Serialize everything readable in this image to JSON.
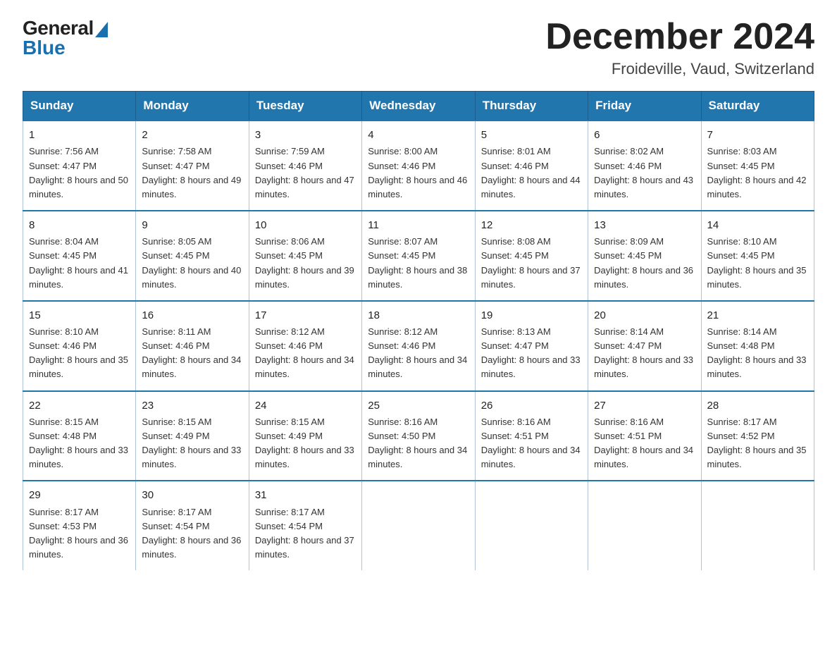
{
  "header": {
    "logo_general": "General",
    "logo_blue": "Blue",
    "month_title": "December 2024",
    "location": "Froideville, Vaud, Switzerland"
  },
  "days_of_week": [
    "Sunday",
    "Monday",
    "Tuesday",
    "Wednesday",
    "Thursday",
    "Friday",
    "Saturday"
  ],
  "weeks": [
    [
      {
        "day": "1",
        "sunrise": "7:56 AM",
        "sunset": "4:47 PM",
        "daylight": "8 hours and 50 minutes."
      },
      {
        "day": "2",
        "sunrise": "7:58 AM",
        "sunset": "4:47 PM",
        "daylight": "8 hours and 49 minutes."
      },
      {
        "day": "3",
        "sunrise": "7:59 AM",
        "sunset": "4:46 PM",
        "daylight": "8 hours and 47 minutes."
      },
      {
        "day": "4",
        "sunrise": "8:00 AM",
        "sunset": "4:46 PM",
        "daylight": "8 hours and 46 minutes."
      },
      {
        "day": "5",
        "sunrise": "8:01 AM",
        "sunset": "4:46 PM",
        "daylight": "8 hours and 44 minutes."
      },
      {
        "day": "6",
        "sunrise": "8:02 AM",
        "sunset": "4:46 PM",
        "daylight": "8 hours and 43 minutes."
      },
      {
        "day": "7",
        "sunrise": "8:03 AM",
        "sunset": "4:45 PM",
        "daylight": "8 hours and 42 minutes."
      }
    ],
    [
      {
        "day": "8",
        "sunrise": "8:04 AM",
        "sunset": "4:45 PM",
        "daylight": "8 hours and 41 minutes."
      },
      {
        "day": "9",
        "sunrise": "8:05 AM",
        "sunset": "4:45 PM",
        "daylight": "8 hours and 40 minutes."
      },
      {
        "day": "10",
        "sunrise": "8:06 AM",
        "sunset": "4:45 PM",
        "daylight": "8 hours and 39 minutes."
      },
      {
        "day": "11",
        "sunrise": "8:07 AM",
        "sunset": "4:45 PM",
        "daylight": "8 hours and 38 minutes."
      },
      {
        "day": "12",
        "sunrise": "8:08 AM",
        "sunset": "4:45 PM",
        "daylight": "8 hours and 37 minutes."
      },
      {
        "day": "13",
        "sunrise": "8:09 AM",
        "sunset": "4:45 PM",
        "daylight": "8 hours and 36 minutes."
      },
      {
        "day": "14",
        "sunrise": "8:10 AM",
        "sunset": "4:45 PM",
        "daylight": "8 hours and 35 minutes."
      }
    ],
    [
      {
        "day": "15",
        "sunrise": "8:10 AM",
        "sunset": "4:46 PM",
        "daylight": "8 hours and 35 minutes."
      },
      {
        "day": "16",
        "sunrise": "8:11 AM",
        "sunset": "4:46 PM",
        "daylight": "8 hours and 34 minutes."
      },
      {
        "day": "17",
        "sunrise": "8:12 AM",
        "sunset": "4:46 PM",
        "daylight": "8 hours and 34 minutes."
      },
      {
        "day": "18",
        "sunrise": "8:12 AM",
        "sunset": "4:46 PM",
        "daylight": "8 hours and 34 minutes."
      },
      {
        "day": "19",
        "sunrise": "8:13 AM",
        "sunset": "4:47 PM",
        "daylight": "8 hours and 33 minutes."
      },
      {
        "day": "20",
        "sunrise": "8:14 AM",
        "sunset": "4:47 PM",
        "daylight": "8 hours and 33 minutes."
      },
      {
        "day": "21",
        "sunrise": "8:14 AM",
        "sunset": "4:48 PM",
        "daylight": "8 hours and 33 minutes."
      }
    ],
    [
      {
        "day": "22",
        "sunrise": "8:15 AM",
        "sunset": "4:48 PM",
        "daylight": "8 hours and 33 minutes."
      },
      {
        "day": "23",
        "sunrise": "8:15 AM",
        "sunset": "4:49 PM",
        "daylight": "8 hours and 33 minutes."
      },
      {
        "day": "24",
        "sunrise": "8:15 AM",
        "sunset": "4:49 PM",
        "daylight": "8 hours and 33 minutes."
      },
      {
        "day": "25",
        "sunrise": "8:16 AM",
        "sunset": "4:50 PM",
        "daylight": "8 hours and 34 minutes."
      },
      {
        "day": "26",
        "sunrise": "8:16 AM",
        "sunset": "4:51 PM",
        "daylight": "8 hours and 34 minutes."
      },
      {
        "day": "27",
        "sunrise": "8:16 AM",
        "sunset": "4:51 PM",
        "daylight": "8 hours and 34 minutes."
      },
      {
        "day": "28",
        "sunrise": "8:17 AM",
        "sunset": "4:52 PM",
        "daylight": "8 hours and 35 minutes."
      }
    ],
    [
      {
        "day": "29",
        "sunrise": "8:17 AM",
        "sunset": "4:53 PM",
        "daylight": "8 hours and 36 minutes."
      },
      {
        "day": "30",
        "sunrise": "8:17 AM",
        "sunset": "4:54 PM",
        "daylight": "8 hours and 36 minutes."
      },
      {
        "day": "31",
        "sunrise": "8:17 AM",
        "sunset": "4:54 PM",
        "daylight": "8 hours and 37 minutes."
      },
      null,
      null,
      null,
      null
    ]
  ],
  "labels": {
    "sunrise_prefix": "Sunrise: ",
    "sunset_prefix": "Sunset: ",
    "daylight_prefix": "Daylight: "
  }
}
